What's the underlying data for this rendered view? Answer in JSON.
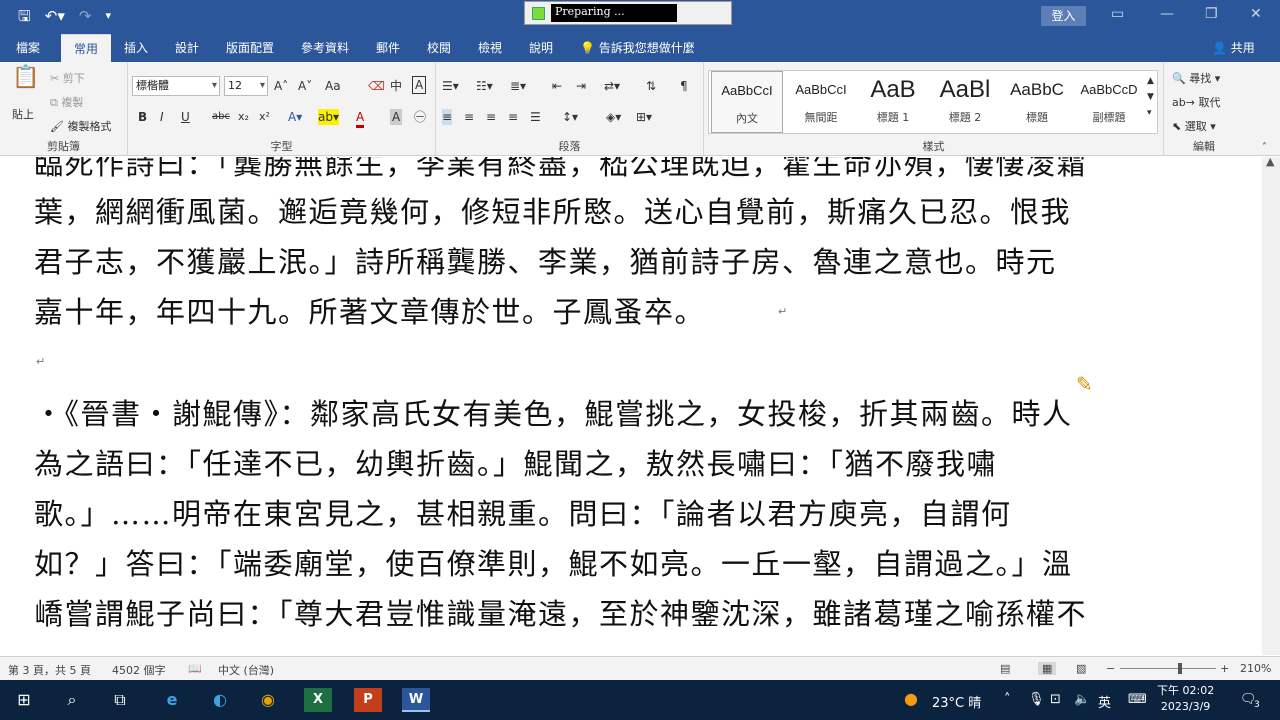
{
  "titlebar": {
    "preparing_text": "Preparing ...",
    "login_label": "登入",
    "qat": [
      "save-icon",
      "undo-icon",
      "redo-icon",
      "customize-icon"
    ]
  },
  "menu": {
    "tabs": [
      "檔案",
      "常用",
      "插入",
      "設計",
      "版面配置",
      "參考資料",
      "郵件",
      "校閱",
      "檢視",
      "說明"
    ],
    "active": "常用",
    "tell_me": "告訴我您想做什麼",
    "share": "共用"
  },
  "ribbon": {
    "clipboard": {
      "label": "剪貼簿",
      "paste": "貼上",
      "cut": "剪下",
      "copy": "複製",
      "format_painter": "複製格式"
    },
    "font": {
      "label": "字型",
      "font_name": "標楷體",
      "font_size": "12",
      "buttons": [
        "B",
        "I",
        "U",
        "abc",
        "x₂",
        "x²",
        "A",
        "Aa"
      ]
    },
    "paragraph": {
      "label": "段落"
    },
    "styles": {
      "label": "樣式",
      "items": [
        {
          "sample": "AaBbCcI",
          "name": "內文",
          "selected": true
        },
        {
          "sample": "AaBbCcI",
          "name": "無間距",
          "selected": false
        },
        {
          "sample": "AaB",
          "name": "標題 1",
          "selected": false
        },
        {
          "sample": "AaBl",
          "name": "標題 2",
          "selected": false
        },
        {
          "sample": "AaBbC",
          "name": "標題",
          "selected": false
        },
        {
          "sample": "AaBbCcD",
          "name": "副標題",
          "selected": false
        }
      ]
    },
    "editing": {
      "label": "編輯",
      "find": "尋找",
      "replace": "取代",
      "select": "選取"
    }
  },
  "document": {
    "lines": [
      "臨死作詩曰：「龔勝無餘生，李業有終盡，嵇公理既迫，霍生命亦殞，悽悽凌霜",
      "葉，網網衝風菌。邂逅竟幾何，修短非所愍。送心自覺前，斯痛久已忍。恨我",
      "君子志，不獲巖上泯。」詩所稱龔勝、李業，猶前詩子房、魯連之意也。時元",
      "嘉十年，年四十九。所著文章傳於世。子鳳蚤卒。",
      "",
      "‧《晉書‧謝鯤傳》：鄰家高氏女有美色，鯤嘗挑之，女投梭，折其兩齒。時人",
      "為之語曰：「任達不已，幼輿折齒。」鯤聞之，敖然長嘯曰：「猶不廢我嘯",
      "歌。」……明帝在東宮見之，甚相親重。問曰：「論者以君方庾亮，自謂何",
      "如？」答曰：「端委廟堂，使百僚準則，鯤不如亮。一丘一壑，自謂過之。」溫",
      "嶠嘗謂鯤子尚曰：「尊大君豈惟識量淹遠，至於神鑒沈深，雖諸葛瑾之喻孫權不"
    ]
  },
  "status": {
    "page": "第 3 頁，共 5 頁",
    "words": "4502 個字",
    "language": "中文 (台灣)",
    "zoom": "210%"
  },
  "taskbar": {
    "weather": "23°C 晴",
    "ime": "英",
    "time": "下午 02:02",
    "date": "2023/3/9",
    "notifications": "3"
  }
}
